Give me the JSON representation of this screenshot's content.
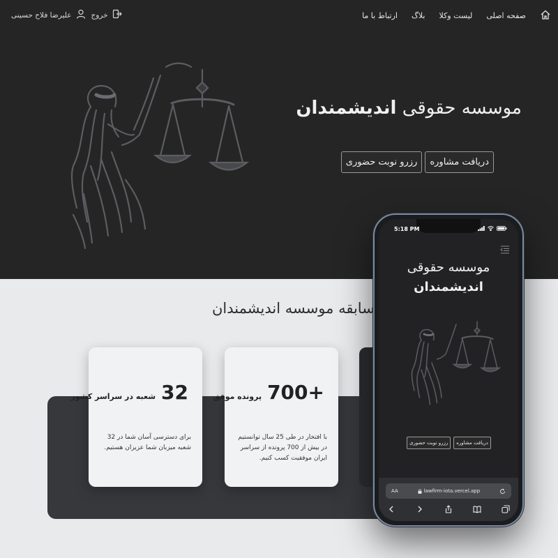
{
  "nav": {
    "items": [
      "صفحه اصلی",
      "لیست وکلا",
      "بلاگ",
      "ارتباط با ما"
    ],
    "logout_label": "خروج",
    "user_name": "علیرضا فلاح حسینی"
  },
  "hero": {
    "title_regular": "موسسه حقوقی",
    "title_bold": "اندیشمندان",
    "buttons": [
      "دریافت مشاوره",
      "رزرو نوبت حضوری"
    ]
  },
  "history": {
    "title": "سابقه موسسه اندیشمندان",
    "cards": [
      {
        "number": "+700",
        "label": "پرونده موفق",
        "description": "با افتخار در طی 25 سال توانستیم در بیش از 700 پرونده از سراسر ایران موفقیت کسب کنیم."
      },
      {
        "number": "32",
        "label": "شعبه در سراسر کشور",
        "description": "برای دسترسی آسان شما در 32 شعبه میزبان شما عزیزان هستیم."
      }
    ]
  },
  "phone": {
    "time": "5:18 PM",
    "title_regular": "موسسه حقوقی",
    "title_bold": "اندیشمندان",
    "buttons": [
      "دریافت مشاوره",
      "رزرو نوبت حضوری"
    ],
    "aa_label": "AA",
    "url": "lawfirm-iota.vercel.app"
  },
  "icons": {
    "home": "home-icon",
    "logout": "logout-icon",
    "user": "user-icon",
    "menu": "menu-icon",
    "lock": "lock-icon",
    "reload": "reload-icon",
    "back": "back-icon",
    "forward": "forward-icon",
    "share": "share-icon",
    "bookmarks": "bookmarks-icon",
    "tabs": "tabs-icon"
  },
  "colors": {
    "hero_bg": "#252526",
    "section_bg": "#e9eaec",
    "band_bg": "#37383c",
    "card_bg": "#f1f2f4"
  }
}
